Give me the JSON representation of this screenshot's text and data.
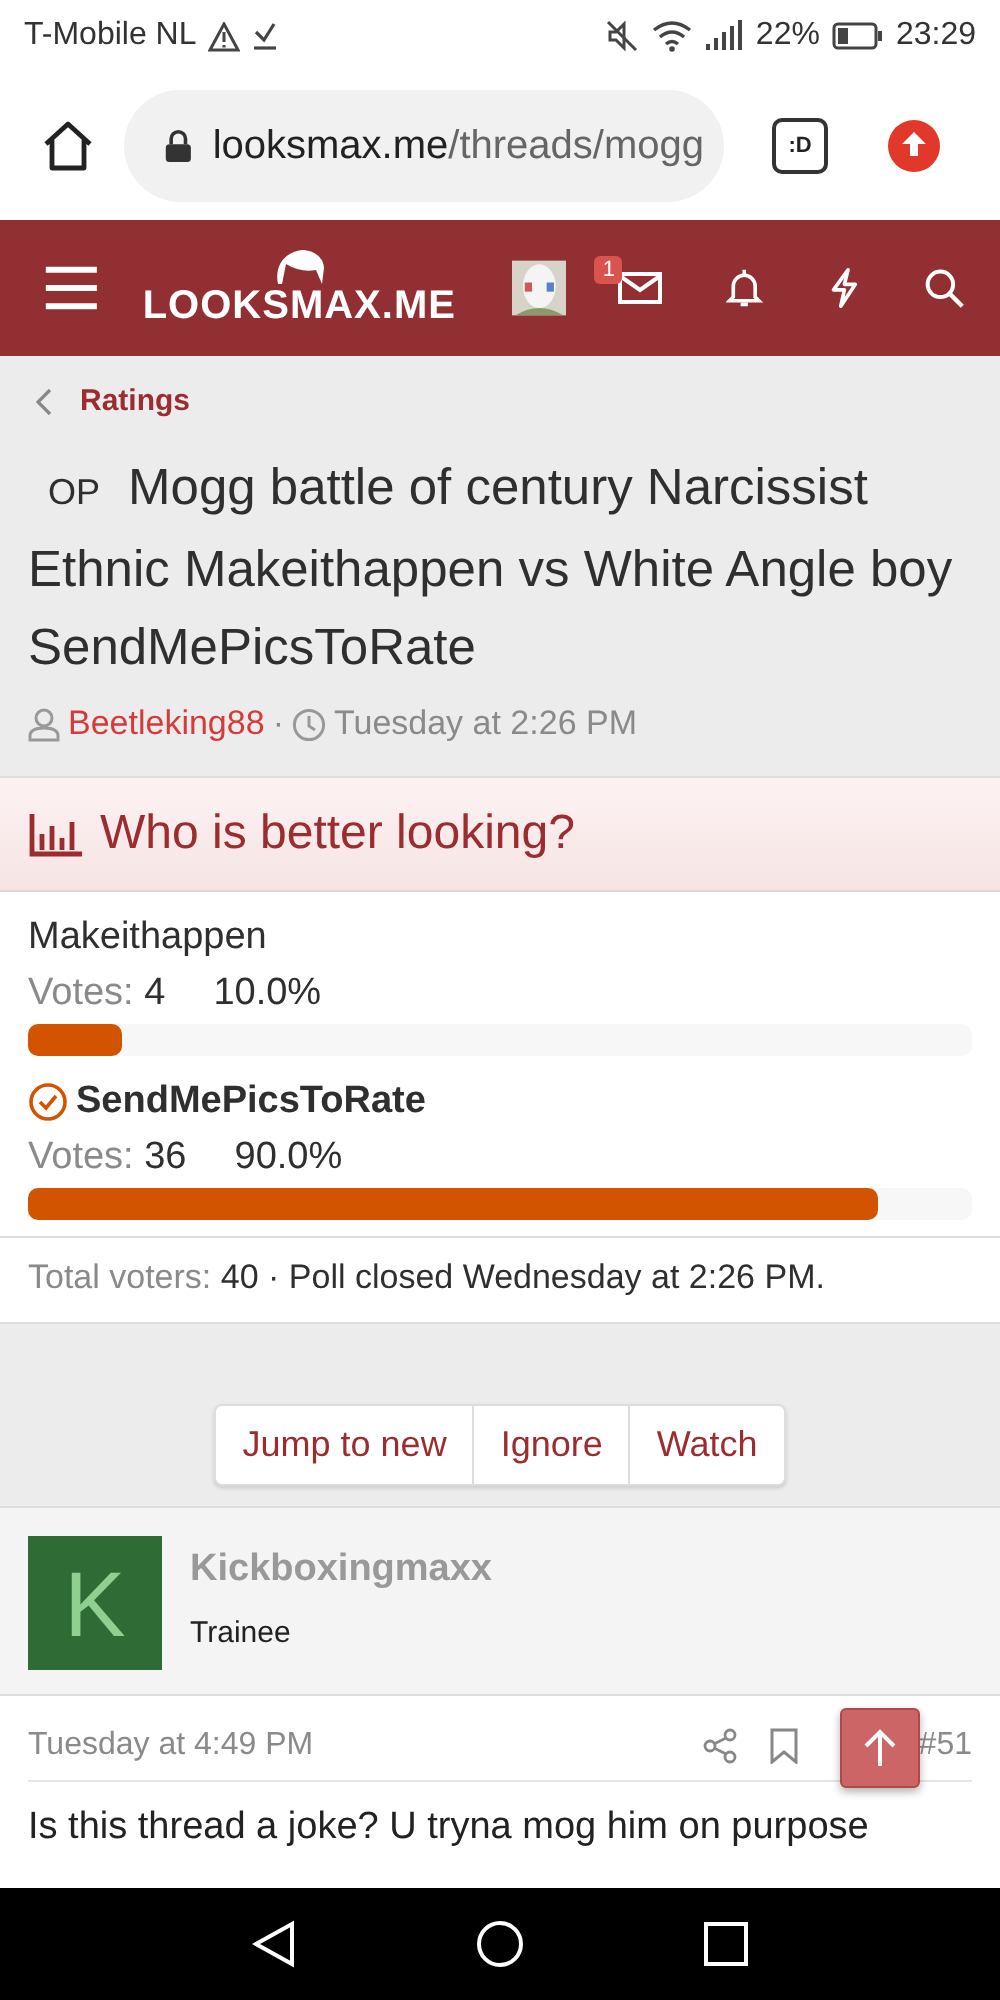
{
  "status_bar": {
    "carrier": "T-Mobile NL",
    "battery": "22%",
    "time": "23:29"
  },
  "browser": {
    "url_host": "looksmax.me",
    "url_path": "/threads/mogg",
    "tab_button": ":D"
  },
  "site_header": {
    "logo": "LOOKSMAX.ME",
    "inbox_badge": "1"
  },
  "breadcrumb": "Ratings",
  "thread": {
    "prefix": "OP",
    "title": "Mogg battle of century Narcissist Ethnic Makeithappen vs White Angle boy SendMePicsToRate",
    "author": "Beetleking88",
    "separator": "·",
    "date": "Tuesday at 2:26 PM"
  },
  "poll": {
    "question": "Who is better looking?",
    "options": [
      {
        "label": "Makeithappen",
        "votes_label": "Votes:",
        "votes": "4",
        "percent": "10.0%",
        "level": 0.1,
        "selected": false
      },
      {
        "label": "SendMePicsToRate",
        "votes_label": "Votes:",
        "votes": "36",
        "percent": "90.0%",
        "level": 0.9,
        "selected": true
      }
    ],
    "total_label": "Total voters:",
    "total": "40",
    "closed": "· Poll closed Wednesday at 2:26 PM."
  },
  "thread_actions": [
    "Jump to new",
    "Ignore",
    "Watch"
  ],
  "post": {
    "avatar_letter": "K",
    "username": "Kickboxingmaxx",
    "user_title": "Trainee",
    "date": "Tuesday at 4:49 PM",
    "number": "#51",
    "body": "Is this thread a joke? U tryna mog him on purpose"
  }
}
